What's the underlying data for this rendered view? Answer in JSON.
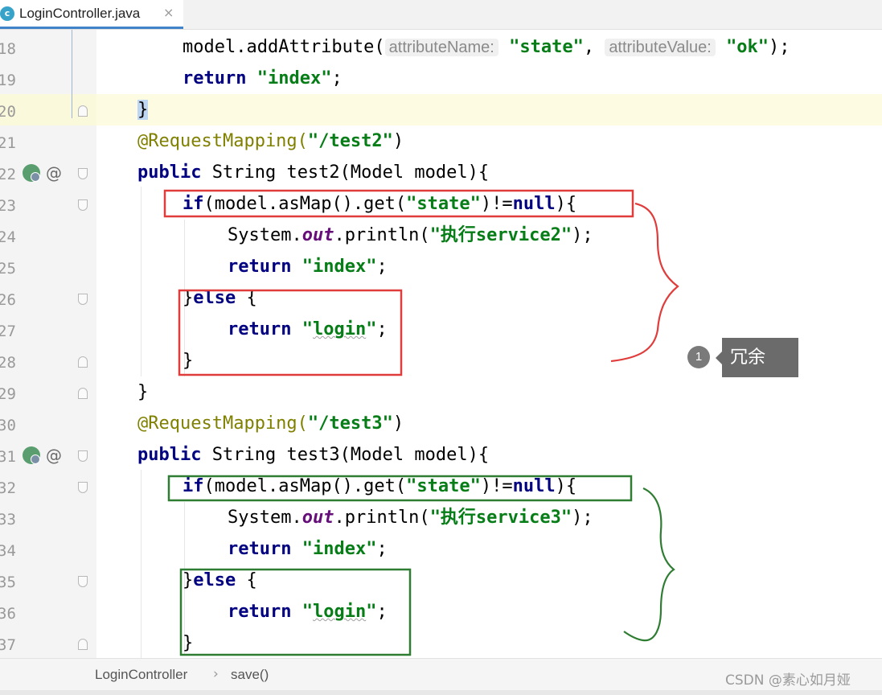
{
  "tab": {
    "icon_letter": "c",
    "file_name": "LoginController.java",
    "close_glyph": "×"
  },
  "gutter": {
    "line_numbers": [
      "18",
      "19",
      "20",
      "21",
      "22",
      "23",
      "24",
      "25",
      "26",
      "27",
      "28",
      "29",
      "30",
      "31",
      "32",
      "33",
      "34",
      "35",
      "36",
      "37"
    ],
    "at_glyph": "@"
  },
  "code": {
    "l18": {
      "p1": "model.addAttribute(",
      "hint1": "attributeName:",
      "s1": "\"state\"",
      "c1": ",",
      "hint2": "attributeValue:",
      "s2": "\"ok\"",
      "end": ");"
    },
    "l19": {
      "kw": "return",
      "str": "\"index\"",
      "end": ";"
    },
    "l20": {
      "brace": "}"
    },
    "l21": {
      "ann": "@RequestMapping(",
      "str": "\"/test2\"",
      "end": ")"
    },
    "l22": {
      "kw": "public",
      "rest": " String test2(Model model){"
    },
    "l23": {
      "kw1": "if",
      "p1": "(model.asMap().get(",
      "str": "\"state\"",
      "p2": ")!=",
      "kw2": "null",
      "end": "){"
    },
    "l24": {
      "p1": "System.",
      "fld": "out",
      "p2": ".println(",
      "str": "\"执行service2\"",
      "end": ");"
    },
    "l25": {
      "kw": "return",
      "str": "\"index\"",
      "end": ";"
    },
    "l26": {
      "p1": "}",
      "kw": "else",
      "end": " {"
    },
    "l27": {
      "kw": "return",
      "q1": "\"",
      "word": "login",
      "q2": "\"",
      "end": ";"
    },
    "l28": {
      "brace": "}"
    },
    "l29": {
      "brace": "}"
    },
    "l30": {
      "ann": "@RequestMapping(",
      "str": "\"/test3\"",
      "end": ")"
    },
    "l31": {
      "kw": "public",
      "rest": " String test3(Model model){"
    },
    "l32": {
      "kw1": "if",
      "p1": "(model.asMap().get(",
      "str": "\"state\"",
      "p2": ")!=",
      "kw2": "null",
      "end": "){"
    },
    "l33": {
      "p1": "System.",
      "fld": "out",
      "p2": ".println(",
      "str": "\"执行service3\"",
      "end": ");"
    },
    "l34": {
      "kw": "return",
      "str": "\"index\"",
      "end": ";"
    },
    "l35": {
      "p1": "}",
      "kw": "else",
      "end": " {"
    },
    "l36": {
      "kw": "return",
      "q1": "\"",
      "word": "login",
      "q2": "\"",
      "end": ";"
    },
    "l37": {
      "brace": "}"
    }
  },
  "annotation": {
    "badge_number": "1",
    "label": "冗余"
  },
  "breadcrumb": {
    "class_name": "LoginController",
    "separator": "›",
    "method": "save()"
  },
  "watermark": "CSDN @素心如月娅",
  "colors": {
    "keyword": "#000080",
    "string": "#067d17",
    "annotation": "#808000",
    "field": "#660e7a",
    "red_box": "#e03c3c",
    "green_box": "#2e7d32",
    "tab_underline": "#4083c9"
  }
}
